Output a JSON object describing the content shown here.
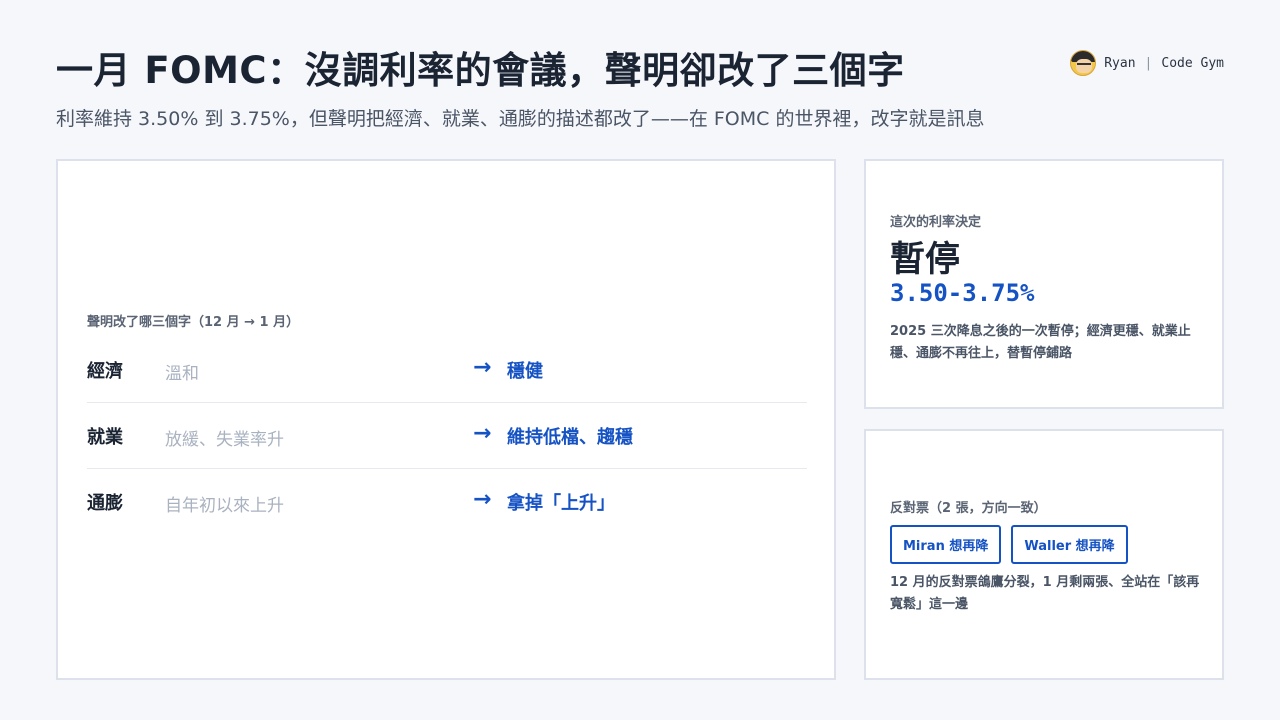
{
  "header": {
    "title": "一月 FOMC：沒調利率的會議，聲明卻改了三個字",
    "subtitle": "利率維持 3.50% 到 3.75%，但聲明把經濟、就業、通膨的描述都改了——在 FOMC 的世界裡，改字就是訊息"
  },
  "brand": {
    "name": "Ryan",
    "separator": "|",
    "channel": "Code Gym",
    "avatar_icon": "avatar-icon"
  },
  "main": {
    "label": "聲明改了哪三個字（12 月 → 1 月）",
    "arrow_glyph": "→",
    "rows": [
      {
        "topic": "經濟",
        "old": "溫和",
        "new": "穩健"
      },
      {
        "topic": "就業",
        "old": "放緩、失業率升",
        "new": "維持低檔、趨穩"
      },
      {
        "topic": "通膨",
        "old": "自年初以來上升",
        "new": "拿掉「上升」"
      }
    ]
  },
  "rate": {
    "label": "這次的利率決定",
    "decision": "暫停",
    "range": "3.50-3.75%",
    "note": "2025 三次降息之後的一次暫停；經濟更穩、就業止穩、通膨不再往上，替暫停鋪路"
  },
  "dissent": {
    "label": "反對票（2 張，方向一致）",
    "chips": [
      "Miran 想再降",
      "Waller 想再降"
    ],
    "note": "12 月的反對票鴿鷹分裂，1 月剩兩張、全站在「該再寬鬆」這一邊"
  },
  "colors": {
    "accent": "#1552c4",
    "muted": "#a9b2c0",
    "text": "#1b2433",
    "background": "#f6f7fb"
  }
}
